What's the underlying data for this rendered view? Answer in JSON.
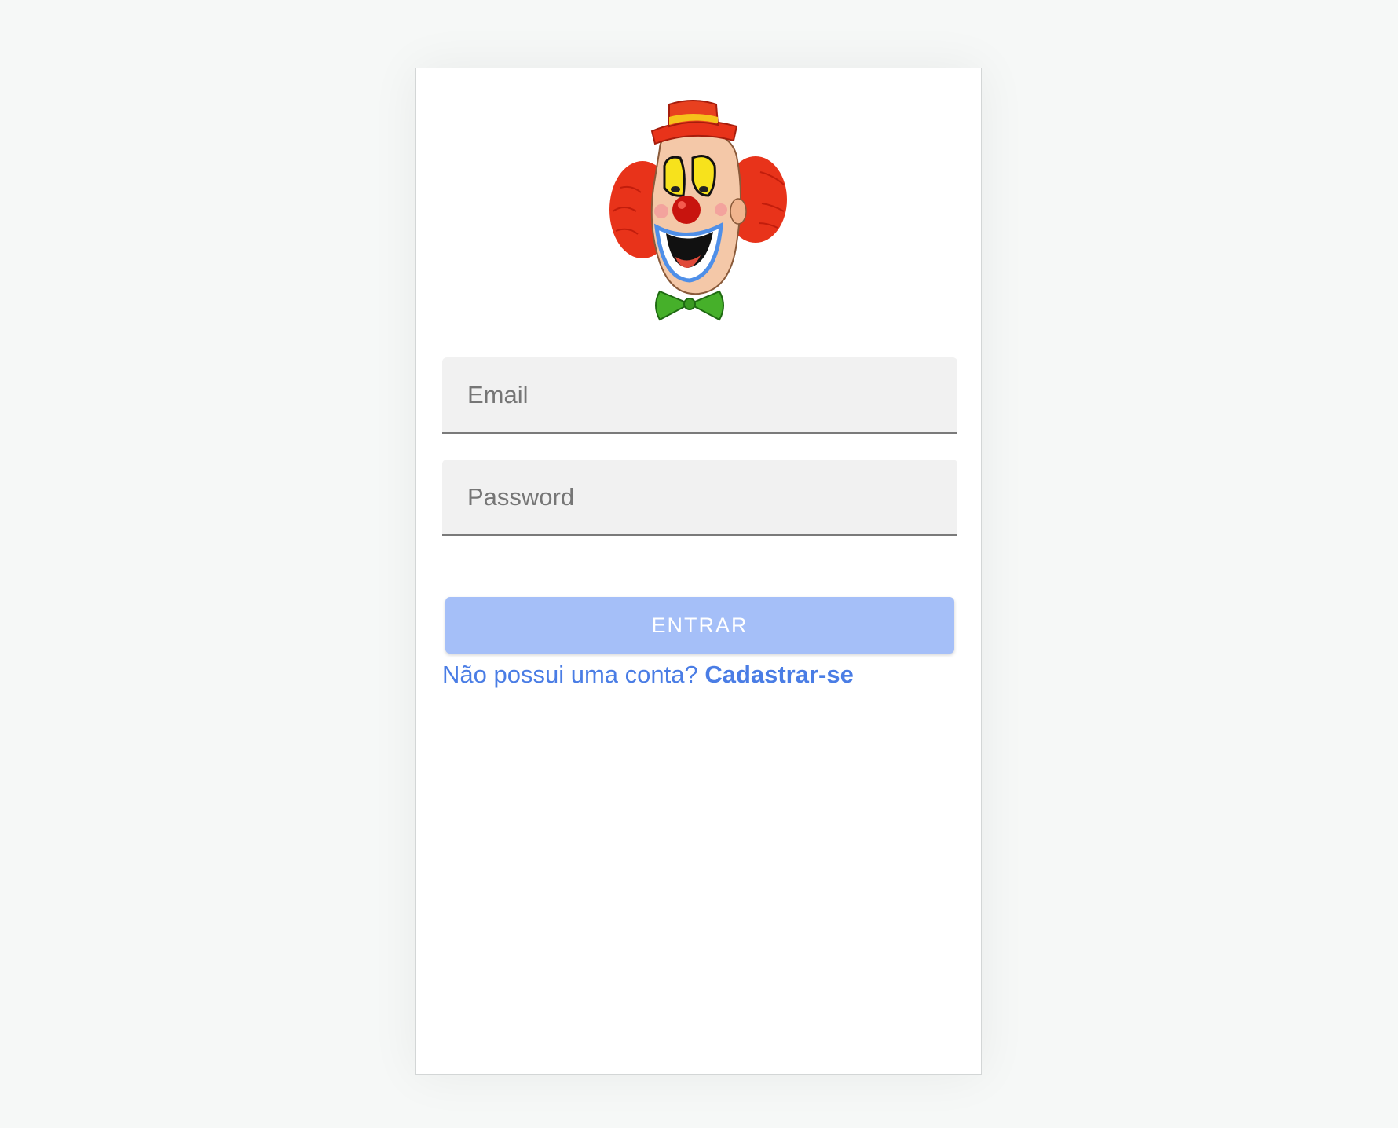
{
  "logo": {
    "icon": "clown-face-logo"
  },
  "form": {
    "email_placeholder": "Email",
    "email_value": "",
    "password_placeholder": "Password",
    "password_value": "",
    "submit_label": "ENTRAR",
    "signup_prompt": "Não possui uma conta?",
    "signup_link": "Cadastrar-se"
  },
  "colors": {
    "button_bg": "#a5bff8",
    "link": "#4a7de5",
    "field_bg": "#f1f1f1",
    "page_bg": "#f6f8f7"
  }
}
